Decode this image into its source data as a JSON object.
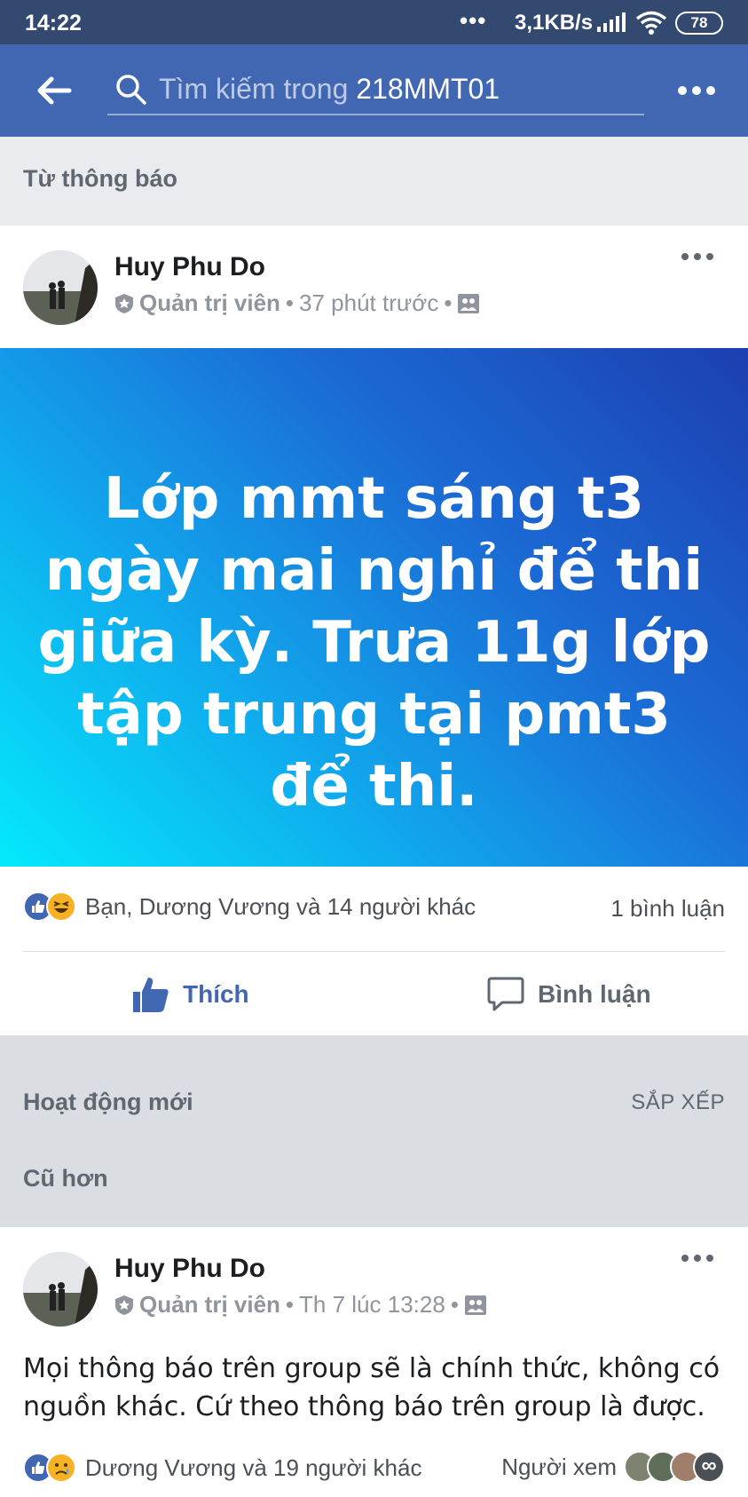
{
  "status_bar": {
    "time": "14:22",
    "dots": "•••",
    "network_speed": "3,1KB/s",
    "battery": "78"
  },
  "app_bar": {
    "search_placeholder": "Tìm kiếm trong ",
    "group_name": "218MMT01"
  },
  "sections": {
    "from_notification": "Từ thông báo",
    "new_activity": "Hoạt động mới",
    "sort": "SẮP XẾP",
    "older": "Cũ hơn"
  },
  "post1": {
    "author": "Huy Phu Do",
    "role": "Quản trị viên",
    "sep": "•",
    "time": "37 phút trước",
    "text": "Lớp mmt sáng t3 ngày mai nghỉ để thi giữa kỳ. Trưa 11g lớp tập trung tại pmt3 để thi.",
    "reactions": "Bạn, Dương Vương và 14 người khác",
    "comments": "1 bình luận",
    "like_label": "Thích",
    "comment_label": "Bình luận"
  },
  "post2": {
    "author": "Huy Phu Do",
    "role": "Quản trị viên",
    "sep": "•",
    "time": "Th 7 lúc 13:28",
    "text": "Mọi thông báo trên group sẽ là chính thức, không có nguồn khác. Cứ theo thông báo trên group là được.",
    "reactions": "Dương Vương và 19 người khác",
    "viewers_label": "Người xem",
    "viewers_more": "∞"
  },
  "colors": {
    "app_bar": "#4267b2",
    "status_bar": "#33496f",
    "like_blue": "#4267b2"
  }
}
